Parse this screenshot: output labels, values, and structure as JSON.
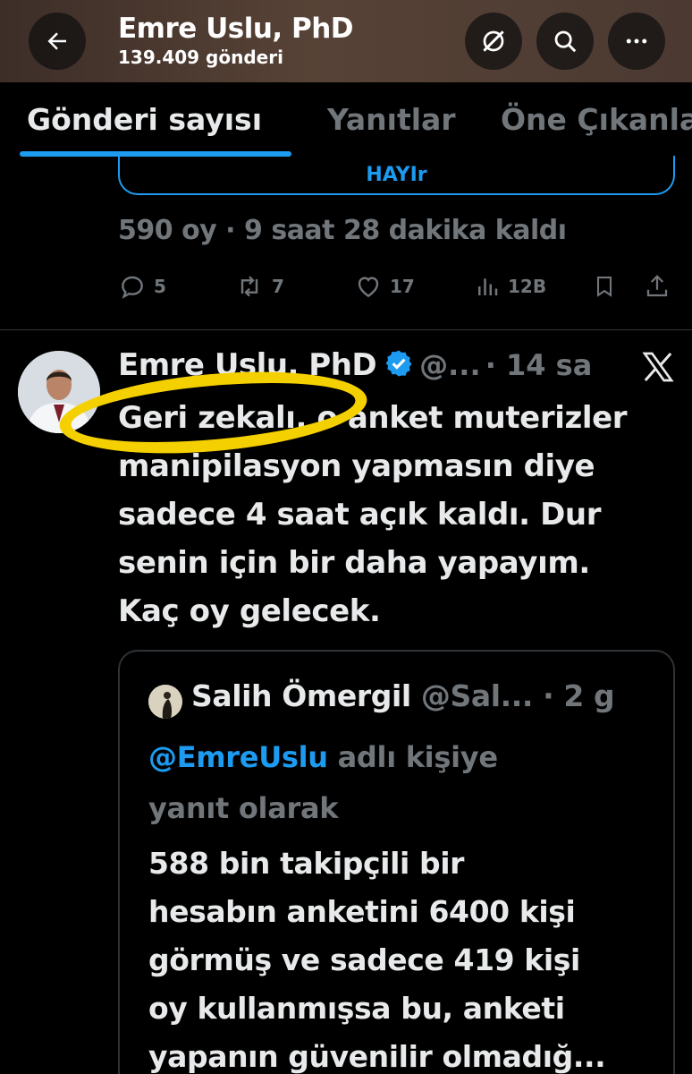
{
  "header": {
    "name": "Emre Uslu, PhD",
    "post_count": "139.409 gönderi",
    "back_icon": "arrow-left-icon",
    "icons": [
      "grok-icon",
      "search-icon",
      "more-icon"
    ]
  },
  "tabs": [
    "Gönderi sayısı",
    "Yanıtlar",
    "Öne Çıkanlar"
  ],
  "poll": {
    "option_label": "HAYIr",
    "info": "590 oy · 9 saat 28 dakika kaldı"
  },
  "actions": {
    "replies": "5",
    "reposts": "7",
    "likes": "17",
    "views": "12B"
  },
  "tweet": {
    "author_name": "Emre Uslu, PhD",
    "handle": "@...",
    "time": "· 14 sa",
    "lines": [
      "Geri zekalı, o anket muterizler",
      "manipilasyon yapmasın diye",
      "sadece 4 saat açık kaldı. Dur",
      "senin için bir daha yapayım.",
      "Kaç oy gelecek."
    ]
  },
  "quote": {
    "author_name": "Salih Ömergil",
    "handle": "@Sal...",
    "time": "· 2 g",
    "mention": "@EmreUslu",
    "reply_suffix": "adlı kişiye",
    "reply_line2": "yanıt olarak",
    "lines": [
      "588 bin takipçili bir",
      "hesabın anketini 6400 kişi",
      "görmüş ve sadece 419 kişi",
      "oy kullanmışsa bu, anketi",
      "yapanın güvenilir olmadığ..."
    ]
  },
  "colors": {
    "accent": "#1d9bf0",
    "highlight": "#f5d000",
    "muted": "#71767b"
  }
}
